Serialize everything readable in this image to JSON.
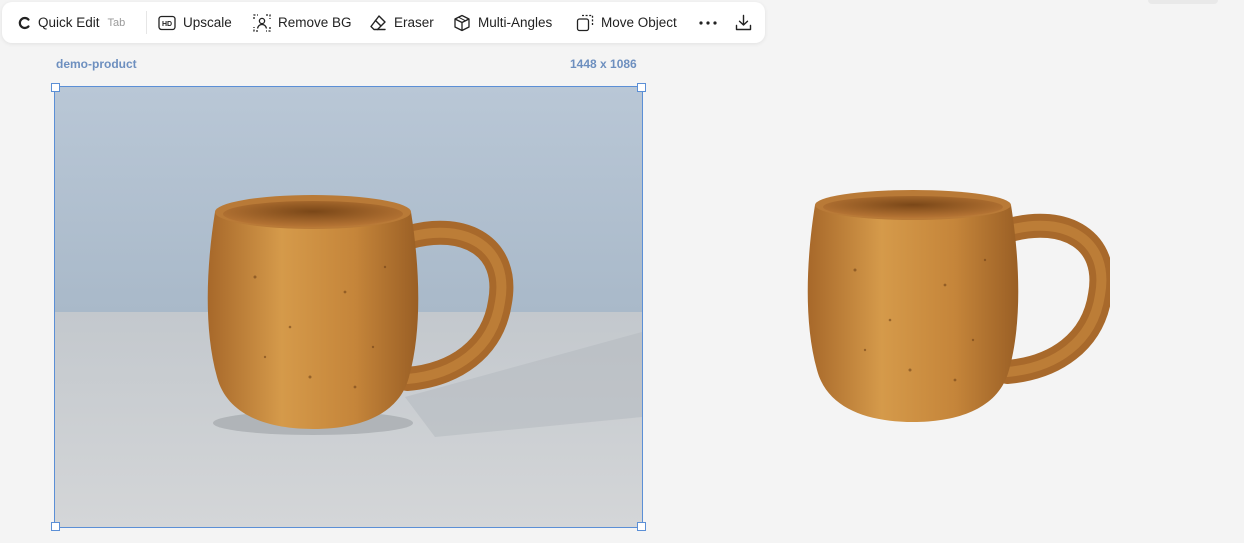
{
  "toolbar": {
    "quick_edit": {
      "label": "Quick Edit",
      "shortcut": "Tab",
      "icon": "quick-edit-icon"
    },
    "tools": [
      {
        "label": "Upscale",
        "icon": "hd-icon"
      },
      {
        "label": "Remove BG",
        "icon": "remove-bg-icon"
      },
      {
        "label": "Eraser",
        "icon": "eraser-icon"
      },
      {
        "label": "Multi-Angles",
        "icon": "cube-icon"
      },
      {
        "label": "Move Object",
        "icon": "move-object-icon"
      }
    ],
    "more_icon": "more-icon",
    "download_icon": "download-icon"
  },
  "canvas": {
    "image_name": "demo-product",
    "image_dimensions": "1448 x 1086"
  },
  "colors": {
    "selection": "#5b8fd6",
    "label": "#6d8fbf",
    "background": "#f4f4f4"
  }
}
